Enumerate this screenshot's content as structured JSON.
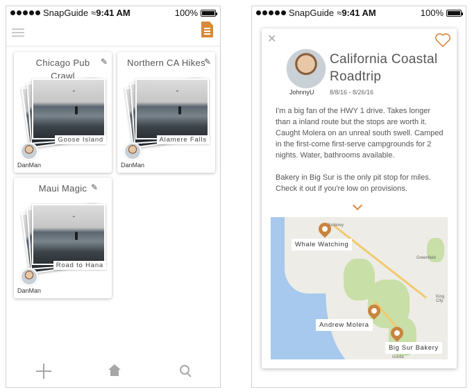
{
  "status_bar": {
    "carrier": "SnapGuide",
    "time": "9:41 AM",
    "battery": "100%"
  },
  "guides": [
    {
      "title": "Chicago Pub Crawl",
      "caption": "Goose Island",
      "user": "DanMan"
    },
    {
      "title": "Northern CA Hikes",
      "caption": "Alamere Falls",
      "user": "DanMan"
    },
    {
      "title": "Maui Magic",
      "caption": "Road to Hana",
      "user": "DanMan"
    }
  ],
  "detail": {
    "title": "California Coastal Roadtrip",
    "author": "JohnnyU",
    "dates": "8/8/16 - 8/26/16",
    "description": "I'm a big fan of the HWY 1 drive. Takes longer than a inland route but the stops are worth it. Caught Molera on an unreal south swell. Camped in the first-come first-serve campgrounds for 2 nights. Water, bathrooms available.\n\nBakery in Big Sur is the only pit stop for miles. Check it out if you're low on provisions.",
    "map": {
      "places": [
        "Monterey",
        "Greenfield",
        "King City",
        "Gorda"
      ],
      "stops": [
        "Whale Watching",
        "Andrew Molera",
        "Big Sur Bakery"
      ]
    }
  },
  "colors": {
    "accent": "#d88a3c",
    "water": "#a6c9ed",
    "park": "#c8dfa8"
  },
  "icons": {
    "menu": "hamburger-icon",
    "doc": "document-icon",
    "edit": "pencil-icon",
    "add": "plus-icon",
    "home": "home-icon",
    "search": "search-icon",
    "close": "close-icon",
    "favorite": "heart-icon",
    "expand": "chevron-down-icon",
    "pin": "map-pin-icon"
  }
}
